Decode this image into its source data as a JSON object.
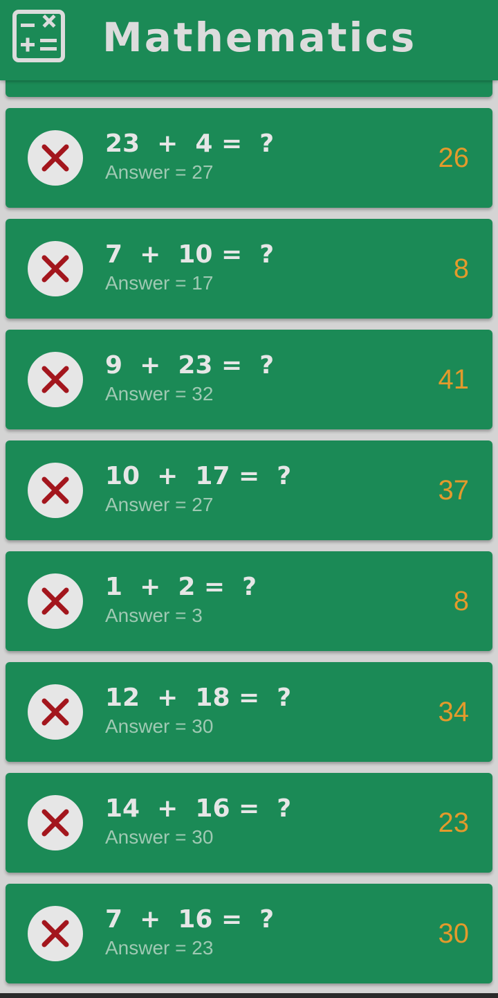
{
  "header": {
    "title": "Mathematics",
    "icon": "calculator-icon",
    "background": "#1b8a56"
  },
  "colors": {
    "card": "#1b8a56",
    "wrong_mark": "#a3161d",
    "user_answer": "#e39a2c",
    "answer_text": "#9fc9b3"
  },
  "results": [
    {
      "question": "23  +  4 =  ?",
      "answer": "Answer = 27",
      "user_answer": "26",
      "status_icon": "wrong-x-icon"
    },
    {
      "question": "7  +  10 =  ?",
      "answer": "Answer = 17",
      "user_answer": "8",
      "status_icon": "wrong-x-icon"
    },
    {
      "question": "9  +  23 =  ?",
      "answer": "Answer = 32",
      "user_answer": "41",
      "status_icon": "wrong-x-icon"
    },
    {
      "question": "10  +  17 =  ?",
      "answer": "Answer = 27",
      "user_answer": "37",
      "status_icon": "wrong-x-icon"
    },
    {
      "question": "1  +  2 =  ?",
      "answer": "Answer = 3",
      "user_answer": "8",
      "status_icon": "wrong-x-icon"
    },
    {
      "question": "12  +  18 =  ?",
      "answer": "Answer = 30",
      "user_answer": "34",
      "status_icon": "wrong-x-icon"
    },
    {
      "question": "14  +  16 =  ?",
      "answer": "Answer = 30",
      "user_answer": "23",
      "status_icon": "wrong-x-icon"
    },
    {
      "question": "7  +  16 =  ?",
      "answer": "Answer = 23",
      "user_answer": "30",
      "status_icon": "wrong-x-icon"
    }
  ]
}
